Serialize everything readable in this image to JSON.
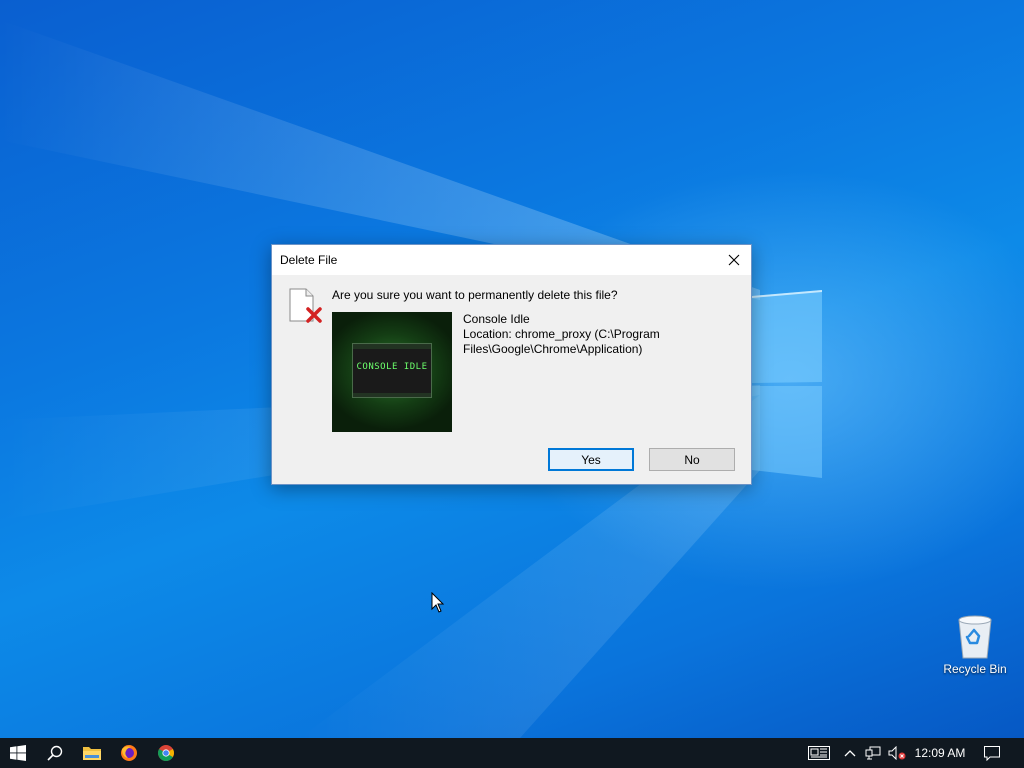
{
  "dialog": {
    "title": "Delete File",
    "question": "Are you sure you want to permanently delete this file?",
    "file_name": "Console Idle",
    "location_line1": "Location: chrome_proxy (C:\\Program",
    "location_line2": "Files\\Google\\Chrome\\Application)",
    "thumbnail_text": "CONSOLE IDLE",
    "yes_label": "Yes",
    "no_label": "No",
    "close_icon": "close-icon",
    "file_icon": "file-delete-icon"
  },
  "desktop": {
    "recycle_bin_label": "Recycle Bin",
    "recycle_bin_icon": "recycle-bin-icon"
  },
  "taskbar": {
    "start_icon": "windows-start-icon",
    "search_icon": "search-icon",
    "pinned": [
      "file-explorer-icon",
      "firefox-icon",
      "chrome-icon"
    ],
    "tray_icons": [
      "news-icon",
      "chevron-up-icon",
      "network-icon",
      "volume-muted-icon"
    ],
    "clock": "12:09 AM",
    "notification_icon": "notification-icon"
  },
  "colors": {
    "accent": "#0078d7",
    "taskbar": "#101820",
    "dialog_bg": "#f0f0f0"
  }
}
